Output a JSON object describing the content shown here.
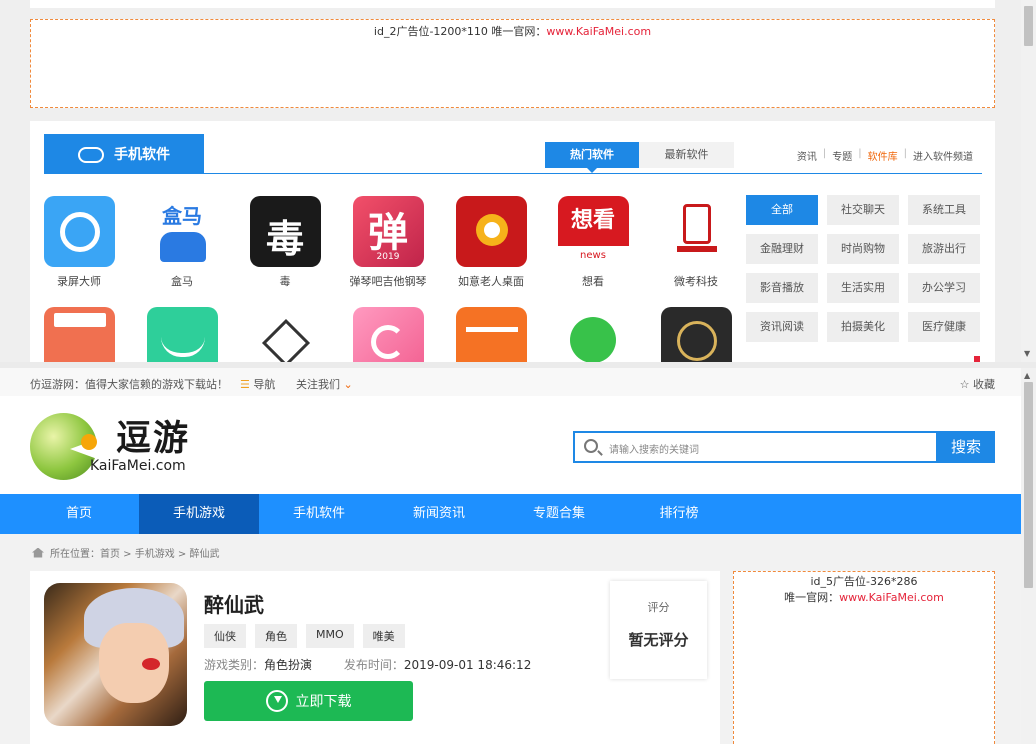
{
  "upper": {
    "ad_top": {
      "text": "id_2广告位-1200*110 唯一官网：",
      "link": "www.KaiFaMei.com"
    },
    "section": {
      "title": "手机软件",
      "tab_hot": "热门软件",
      "tab_new": "最新软件",
      "links": [
        "资讯",
        "专题",
        "软件库",
        "进入软件频道"
      ]
    },
    "apps_row1": [
      {
        "name": "录屏大师",
        "color": "#3aa5f5"
      },
      {
        "name": "盒马",
        "color": "#ffffff"
      },
      {
        "name": "毒",
        "color": "#1a1a1a"
      },
      {
        "name": "弹琴吧吉他钢琴",
        "color": "#e8354a"
      },
      {
        "name": "如意老人桌面",
        "color": "#c8191b"
      },
      {
        "name": "想看",
        "color": "#d71920"
      },
      {
        "name": "微考科技",
        "color": "#ffffff"
      }
    ],
    "apps_row2": [
      {
        "color": "#f07050"
      },
      {
        "color": "#2ecf9a"
      },
      {
        "color": "#ffffff"
      },
      {
        "color": "#f77aa2"
      },
      {
        "color": "#f57224"
      },
      {
        "color": "#ffffff"
      },
      {
        "color": "#2a2a2a"
      }
    ],
    "icon_text": {
      "box": "盒马",
      "du": "毒",
      "tan": "弹",
      "year": "2019",
      "xiang": "想看",
      "news": "news"
    },
    "categories": [
      "全部",
      "社交聊天",
      "系统工具",
      "金融理财",
      "时尚购物",
      "旅游出行",
      "影音播放",
      "生活实用",
      "办公学习",
      "资讯阅读",
      "拍摄美化",
      "医疗健康"
    ]
  },
  "site": {
    "slogan": "仿逗游网：值得大家信赖的游戏下载站！",
    "nav_label": "导航",
    "follow_label": "关注我们",
    "favorite_label": "收藏",
    "logo_title": "逗游",
    "logo_sub": "KaiFaMei.com",
    "search_placeholder": "请输入搜索的关键词",
    "search_button": "搜索",
    "menu": [
      "首页",
      "手机游戏",
      "手机软件",
      "新闻资讯",
      "专题合集",
      "排行榜"
    ],
    "breadcrumb": "所在位置：首页 > 手机游戏 > 醉仙武"
  },
  "game": {
    "name": "醉仙武",
    "tags": [
      "仙侠",
      "角色",
      "MMO",
      "唯美"
    ],
    "type_label": "游戏类别：",
    "type_value": "角色扮演",
    "time_label": "发布时间：",
    "time_value": "2019-09-01 18:46:12",
    "download_label": "立即下载",
    "score_label": "评分",
    "score_value": "暂无评分"
  },
  "ad_side": {
    "line1": "id_5广告位-326*286",
    "line2": "唯一官网：",
    "link": "www.KaiFaMei.com"
  }
}
